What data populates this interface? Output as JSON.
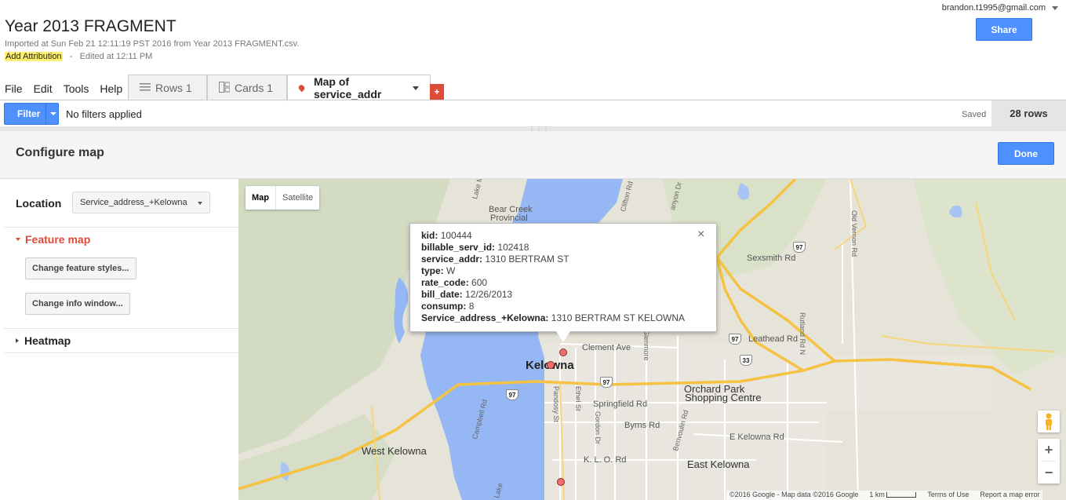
{
  "header": {
    "title": "Year 2013 FRAGMENT",
    "imported": "Imported at Sun Feb 21 12:11:19 PST 2016 from Year 2013 FRAGMENT.csv.",
    "add_attribution": "Add Attribution",
    "meta_sep": "-",
    "edited": "Edited at 12:11 PM",
    "user_email": "brandon.t1995@gmail.com",
    "share_label": "Share"
  },
  "menu": [
    "File",
    "Edit",
    "Tools",
    "Help"
  ],
  "tabs": [
    {
      "label": "Rows 1",
      "icon": "rows-icon"
    },
    {
      "label": "Cards 1",
      "icon": "cards-icon"
    },
    {
      "label": "Map of service_addr",
      "icon": "map-pin-icon",
      "active": true
    }
  ],
  "add_tab": "+",
  "filter": {
    "button_label": "Filter",
    "status": "No filters applied",
    "saved": "Saved",
    "rows": "28 rows"
  },
  "config": {
    "title": "Configure map",
    "done_label": "Done",
    "location_label": "Location",
    "location_value": "Service_address_+Kelowna",
    "feature_map": "Feature map",
    "change_styles": "Change feature styles...",
    "change_info": "Change info window...",
    "heatmap": "Heatmap"
  },
  "map": {
    "type_map": "Map",
    "type_satellite": "Satellite",
    "labels": {
      "kelowna": "Kelowna",
      "west_kelowna": "West Kelowna",
      "east_kelowna": "East Kelowna",
      "bear_creek": "Bear Creek",
      "bear_creek2": "Provincial",
      "orchard": "Orchard Park",
      "orchard2": "Shopping Centre",
      "clement": "Clement Ave",
      "springfield": "Springfield Rd",
      "byrns": "Byrns Rd",
      "klo": "K. L. O. Rd",
      "e_kelowna_rd": "E Kelowna Rd",
      "leathead": "Leathead Rd",
      "sexsmith": "Sexsmith Rd",
      "lake_main": "Lake Main Rd",
      "pandosy": "Pandosy St",
      "ethel": "Ethel St",
      "gordon": "Gordon Dr",
      "campbell": "Campbell Rd",
      "old_vernon": "Old Vernon Rd",
      "rutland": "Rutland Rd N",
      "clifton": "Clifton Rd",
      "benvoulin": "Benvoulin Rd",
      "glenmore": "Glenmore",
      "lake": "Lake",
      "canyon": "anyon Dr"
    },
    "shields": {
      "h97a": "97",
      "h97b": "97",
      "h97c": "97",
      "h97d": "97",
      "h33": "33"
    },
    "info": {
      "fields": [
        {
          "key": "kid:",
          "value": "100444"
        },
        {
          "key": "billable_serv_id:",
          "value": "102418"
        },
        {
          "key": "service_addr:",
          "value": "1310 BERTRAM ST"
        },
        {
          "key": "type:",
          "value": "W"
        },
        {
          "key": "rate_code:",
          "value": "600"
        },
        {
          "key": "bill_date:",
          "value": "12/26/2013"
        },
        {
          "key": "consump:",
          "value": "8"
        },
        {
          "key": "Service_address_+Kelowna:",
          "value": "1310 BERTRAM ST KELOWNA"
        }
      ],
      "close": "×"
    },
    "attribution": {
      "copyright": "©2016 Google - Map data ©2016 Google",
      "scale": "1 km",
      "terms": "Terms of Use",
      "report": "Report a map error"
    },
    "zoom_in": "+",
    "zoom_out": "−"
  }
}
